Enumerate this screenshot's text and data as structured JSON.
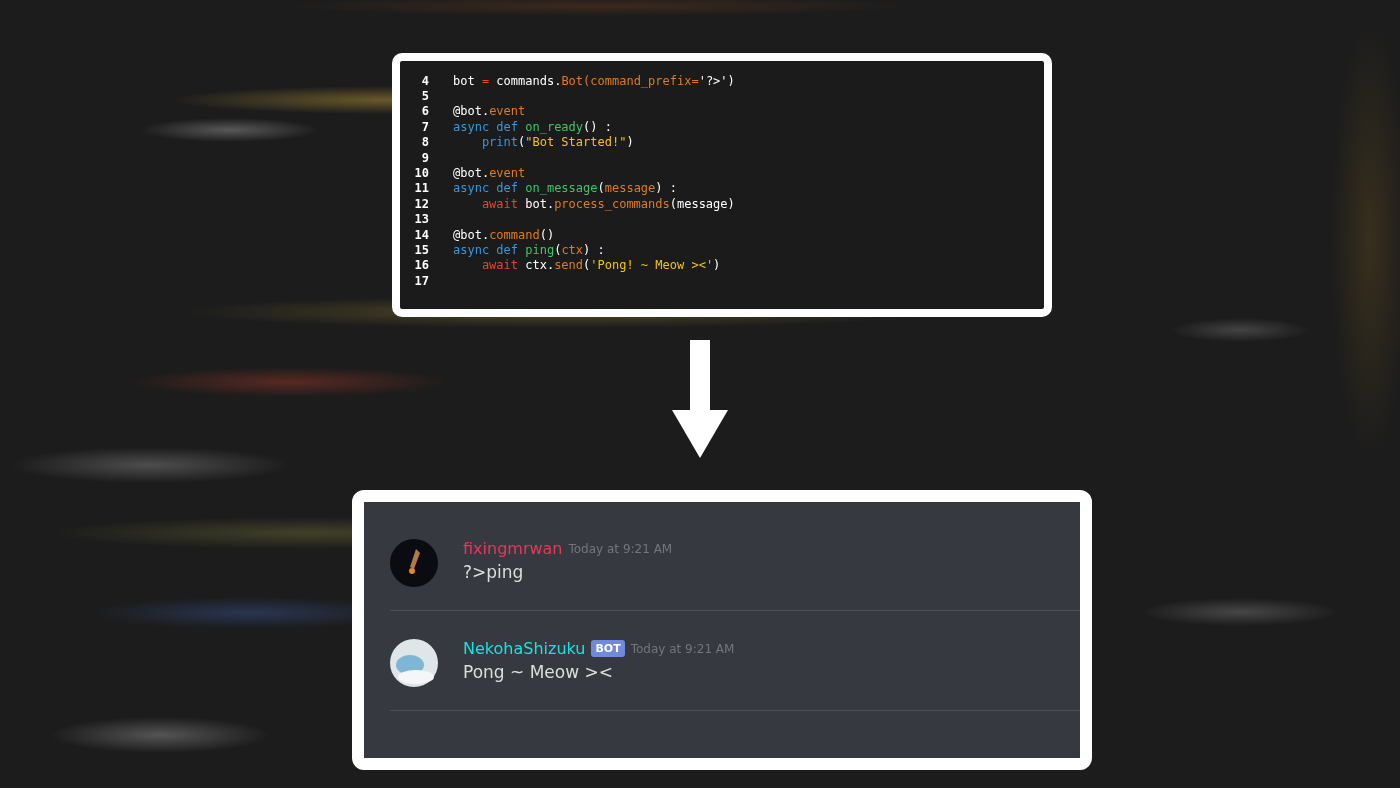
{
  "code_editor": {
    "lines": [
      {
        "number": "4",
        "indent": false,
        "tokens": [
          {
            "kind": "plain",
            "text": "bot "
          },
          {
            "kind": "operator",
            "text": "="
          },
          {
            "kind": "plain",
            "text": " commands."
          },
          {
            "kind": "member",
            "text": "Bot(command_prefix="
          },
          {
            "kind": "plain",
            "text": "'?>')"
          }
        ]
      },
      {
        "number": "5"
      },
      {
        "number": "6",
        "indent": false,
        "tokens": [
          {
            "kind": "plain",
            "text": "@bot."
          },
          {
            "kind": "member",
            "text": "event"
          }
        ]
      },
      {
        "number": "7",
        "indent": false,
        "tokens": [
          {
            "kind": "keyword",
            "text": "async def "
          },
          {
            "kind": "function",
            "text": "on_ready"
          },
          {
            "kind": "plain",
            "text": "() :"
          }
        ]
      },
      {
        "number": "8",
        "indent": true,
        "tokens": [
          {
            "kind": "keyword",
            "text": "print"
          },
          {
            "kind": "plain",
            "text": "("
          },
          {
            "kind": "string",
            "text": "\"Bot Started!\""
          },
          {
            "kind": "plain",
            "text": ")"
          }
        ]
      },
      {
        "number": "9"
      },
      {
        "number": "10",
        "indent": false,
        "tokens": [
          {
            "kind": "plain",
            "text": "@bot."
          },
          {
            "kind": "member",
            "text": "event"
          }
        ]
      },
      {
        "number": "11",
        "indent": false,
        "tokens": [
          {
            "kind": "keyword",
            "text": "async def "
          },
          {
            "kind": "function",
            "text": "on_message"
          },
          {
            "kind": "plain",
            "text": "("
          },
          {
            "kind": "member",
            "text": "message"
          },
          {
            "kind": "plain",
            "text": ") :"
          }
        ]
      },
      {
        "number": "12",
        "indent": true,
        "tokens": [
          {
            "kind": "operator",
            "text": "await"
          },
          {
            "kind": "plain",
            "text": " bot."
          },
          {
            "kind": "member",
            "text": "process_commands"
          },
          {
            "kind": "plain",
            "text": "(message)"
          }
        ]
      },
      {
        "number": "13"
      },
      {
        "number": "14",
        "indent": false,
        "tokens": [
          {
            "kind": "plain",
            "text": "@bot."
          },
          {
            "kind": "member",
            "text": "command"
          },
          {
            "kind": "plain",
            "text": "()"
          }
        ]
      },
      {
        "number": "15",
        "indent": false,
        "tokens": [
          {
            "kind": "keyword",
            "text": "async def "
          },
          {
            "kind": "function",
            "text": "ping"
          },
          {
            "kind": "plain",
            "text": "("
          },
          {
            "kind": "member",
            "text": "ctx"
          },
          {
            "kind": "plain",
            "text": ") :"
          }
        ]
      },
      {
        "number": "16",
        "indent": true,
        "tokens": [
          {
            "kind": "operator",
            "text": "await"
          },
          {
            "kind": "plain",
            "text": " ctx."
          },
          {
            "kind": "member",
            "text": "send"
          },
          {
            "kind": "plain",
            "text": "("
          },
          {
            "kind": "string",
            "text": "'Pong! ~ Meow ><'"
          },
          {
            "kind": "plain",
            "text": ")"
          }
        ]
      },
      {
        "number": "17"
      }
    ]
  },
  "chat": {
    "messages": [
      {
        "author": "fixingmrwan",
        "color": "#e8365c",
        "timestamp": "Today at 9:21 AM",
        "text": "?>ping"
      },
      {
        "author": "NekohaShizuku",
        "color": "#1fe0e0",
        "badge": "BOT",
        "timestamp": "Today at 9:21 AM",
        "text": "Pong ~ Meow ><"
      }
    ]
  }
}
